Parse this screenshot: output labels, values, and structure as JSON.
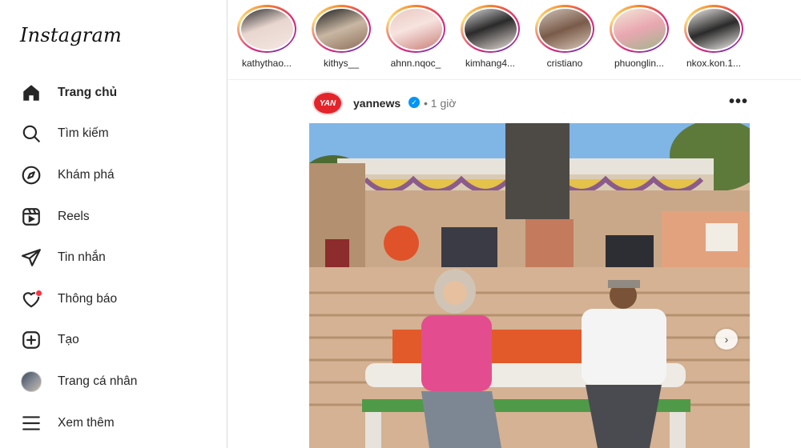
{
  "app": {
    "logo": "Instagram"
  },
  "sidebar": {
    "items": [
      {
        "label": "Trang chủ",
        "icon": "home-icon",
        "active": true
      },
      {
        "label": "Tìm kiếm",
        "icon": "search-icon"
      },
      {
        "label": "Khám phá",
        "icon": "compass-icon"
      },
      {
        "label": "Reels",
        "icon": "reels-icon"
      },
      {
        "label": "Tin nhắn",
        "icon": "send-icon"
      },
      {
        "label": "Thông báo",
        "icon": "heart-icon"
      },
      {
        "label": "Tạo",
        "icon": "plus-square-icon"
      },
      {
        "label": "Trang cá nhân",
        "icon": "profile-avatar"
      },
      {
        "label": "Xem thêm",
        "icon": "menu-icon"
      }
    ]
  },
  "stories": [
    {
      "username": "kathythao..."
    },
    {
      "username": "kithys__"
    },
    {
      "username": "ahnn.nqoc_"
    },
    {
      "username": "kimhang4..."
    },
    {
      "username": "cristiano"
    },
    {
      "username": "phuonglin..."
    },
    {
      "username": "nkox.kon.1..."
    }
  ],
  "post": {
    "username": "yannews",
    "avatar_text": "YAN",
    "separator": "•",
    "time": "1 giờ",
    "more": "•••",
    "next_arrow": "›"
  },
  "colors": {
    "accent": "#0095f6",
    "notification": "#ff3040",
    "brand_red": "#e3242b"
  }
}
